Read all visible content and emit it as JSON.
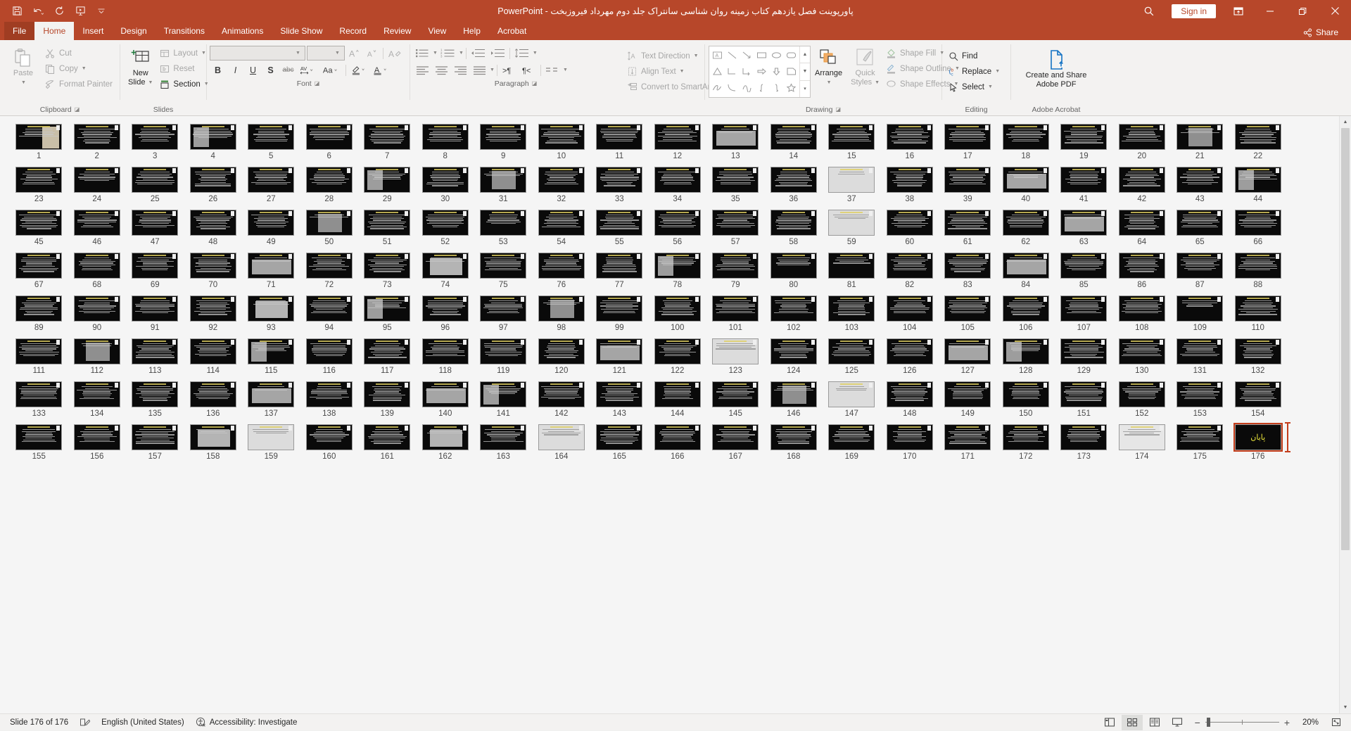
{
  "window": {
    "title": "پاورپوینت فصل یازدهم کتاب زمینه روان شناسی سانتراک جلد دوم مهرداد فیروزبخت",
    "app_suffix": "-  PowerPoint",
    "signin_label": "Sign in",
    "search_icon": "search-icon",
    "ribbon_display_icon": "ribbon-display-options-icon",
    "minimize_icon": "minimize-icon",
    "restore_icon": "restore-icon",
    "close_icon": "close-icon",
    "share_label": "Share"
  },
  "qat": [
    {
      "name": "save-icon",
      "label": "Save"
    },
    {
      "name": "undo-icon",
      "label": "Undo"
    },
    {
      "name": "redo-icon",
      "label": "Redo"
    },
    {
      "name": "start-from-beginning-icon",
      "label": "Start From Beginning"
    },
    {
      "name": "customize-qat-icon",
      "label": "Customize Quick Access Toolbar"
    }
  ],
  "tabs": [
    {
      "label": "File",
      "active": false,
      "file": true
    },
    {
      "label": "Home",
      "active": true,
      "file": false
    },
    {
      "label": "Insert",
      "active": false,
      "file": false
    },
    {
      "label": "Design",
      "active": false,
      "file": false
    },
    {
      "label": "Transitions",
      "active": false,
      "file": false
    },
    {
      "label": "Animations",
      "active": false,
      "file": false
    },
    {
      "label": "Slide Show",
      "active": false,
      "file": false
    },
    {
      "label": "Record",
      "active": false,
      "file": false
    },
    {
      "label": "Review",
      "active": false,
      "file": false
    },
    {
      "label": "View",
      "active": false,
      "file": false
    },
    {
      "label": "Help",
      "active": false,
      "file": false
    },
    {
      "label": "Acrobat",
      "active": false,
      "file": false
    }
  ],
  "ribbon": {
    "groups": {
      "clipboard": {
        "label": "Clipboard",
        "paste": "Paste",
        "cut": "Cut",
        "copy": "Copy",
        "format_painter": "Format Painter"
      },
      "slides": {
        "label": "Slides",
        "new_slide": "New\nSlide",
        "new_slide_line1": "New",
        "new_slide_line2": "Slide",
        "layout": "Layout",
        "reset": "Reset",
        "section": "Section"
      },
      "font": {
        "label": "Font",
        "font_name": "",
        "font_size": "",
        "increase_size": "A",
        "decrease_size": "A",
        "clear_formatting": "Clear All Formatting",
        "bold": "B",
        "italic": "I",
        "underline": "U",
        "shadow": "S",
        "strikethrough": "abc",
        "character_spacing": "AV",
        "change_case": "Aa",
        "text_highlight": "Text Highlight Color",
        "font_color": "A"
      },
      "paragraph": {
        "label": "Paragraph",
        "bullets": "Bullets",
        "numbering": "Numbering",
        "decrease_indent": "Decrease List Level",
        "increase_indent": "Increase List Level",
        "line_spacing": "Line Spacing",
        "align_left": "Align Left",
        "center": "Center",
        "align_right": "Align Right",
        "justify": "Justify",
        "ltr": "Left-to-Right Text Direction",
        "rtl": "Right-to-Left Text Direction",
        "columns": "Columns",
        "text_direction": "Text Direction",
        "align_text": "Align Text",
        "convert_smartart": "Convert to SmartArt"
      },
      "drawing": {
        "label": "Drawing",
        "arrange": "Arrange",
        "quick_styles_line1": "Quick",
        "quick_styles_line2": "Styles",
        "shape_fill": "Shape Fill",
        "shape_outline": "Shape Outline",
        "shape_effects": "Shape Effects"
      },
      "editing": {
        "label": "Editing",
        "find": "Find",
        "replace": "Replace",
        "select": "Select"
      },
      "acrobat": {
        "label": "Adobe Acrobat",
        "create_share_line1": "Create and Share",
        "create_share_line2": "Adobe PDF"
      }
    }
  },
  "status": {
    "slide_position": "Slide 176 of 176",
    "notes_icon": "notes-icon",
    "language": "English (United States)",
    "accessibility_icon": "accessibility-icon",
    "accessibility": "Accessibility: Investigate",
    "zoom_level": "20%",
    "views": [
      {
        "name": "normal-view-button",
        "label": "Normal",
        "active": false
      },
      {
        "name": "slide-sorter-view-button",
        "label": "Slide Sorter",
        "active": true
      },
      {
        "name": "reading-view-button",
        "label": "Reading View",
        "active": false
      },
      {
        "name": "slide-show-button",
        "label": "Slide Show",
        "active": false
      }
    ],
    "fit_to_window": "Fit slide to current window"
  },
  "sorter": {
    "total_slides": 176,
    "selected_slide": 176,
    "caret_after_slide": 176,
    "end_slide_text": "پایان",
    "slides": [
      {
        "n": 1,
        "type": "title-image",
        "lines": 5
      },
      {
        "n": 2,
        "type": "text",
        "lines": 9
      },
      {
        "n": 3,
        "type": "text",
        "lines": 8
      },
      {
        "n": 4,
        "type": "image-left",
        "lines": 6
      },
      {
        "n": 5,
        "type": "text",
        "lines": 8
      },
      {
        "n": 6,
        "type": "text",
        "lines": 7
      },
      {
        "n": 7,
        "type": "text",
        "lines": 9
      },
      {
        "n": 8,
        "type": "text",
        "lines": 8
      },
      {
        "n": 9,
        "type": "text",
        "lines": 8
      },
      {
        "n": 10,
        "type": "text",
        "lines": 9
      },
      {
        "n": 11,
        "type": "text",
        "lines": 8
      },
      {
        "n": 12,
        "type": "text",
        "lines": 8
      },
      {
        "n": 13,
        "type": "image-wide",
        "lines": 3
      },
      {
        "n": 14,
        "type": "text",
        "lines": 9
      },
      {
        "n": 15,
        "type": "text",
        "lines": 8
      },
      {
        "n": 16,
        "type": "text",
        "lines": 9
      },
      {
        "n": 17,
        "type": "text",
        "lines": 8
      },
      {
        "n": 18,
        "type": "text",
        "lines": 8
      },
      {
        "n": 19,
        "type": "text",
        "lines": 9
      },
      {
        "n": 20,
        "type": "text",
        "lines": 8
      },
      {
        "n": 21,
        "type": "image-center",
        "lines": 3
      },
      {
        "n": 22,
        "type": "text",
        "lines": 9
      },
      {
        "n": 23,
        "type": "text",
        "lines": 8
      },
      {
        "n": 24,
        "type": "text",
        "lines": 6
      },
      {
        "n": 25,
        "type": "text",
        "lines": 8
      },
      {
        "n": 26,
        "type": "text",
        "lines": 9
      },
      {
        "n": 27,
        "type": "text",
        "lines": 8
      },
      {
        "n": 28,
        "type": "text",
        "lines": 8
      },
      {
        "n": 29,
        "type": "image-left",
        "lines": 5
      },
      {
        "n": 30,
        "type": "text",
        "lines": 9
      },
      {
        "n": 31,
        "type": "image-center",
        "lines": 3
      },
      {
        "n": 32,
        "type": "text",
        "lines": 8
      },
      {
        "n": 33,
        "type": "text",
        "lines": 9
      },
      {
        "n": 34,
        "type": "text",
        "lines": 8
      },
      {
        "n": 35,
        "type": "text",
        "lines": 8
      },
      {
        "n": 36,
        "type": "text",
        "lines": 9
      },
      {
        "n": 37,
        "type": "image-pale",
        "lines": 2
      },
      {
        "n": 38,
        "type": "text",
        "lines": 9
      },
      {
        "n": 39,
        "type": "text",
        "lines": 8
      },
      {
        "n": 40,
        "type": "image-wide",
        "lines": 4
      },
      {
        "n": 41,
        "type": "text",
        "lines": 8
      },
      {
        "n": 42,
        "type": "text",
        "lines": 9
      },
      {
        "n": 43,
        "type": "text",
        "lines": 8
      },
      {
        "n": 44,
        "type": "image-left",
        "lines": 5
      },
      {
        "n": 45,
        "type": "text",
        "lines": 9
      },
      {
        "n": 46,
        "type": "text",
        "lines": 8
      },
      {
        "n": 47,
        "type": "text",
        "lines": 8
      },
      {
        "n": 48,
        "type": "text",
        "lines": 9
      },
      {
        "n": 49,
        "type": "text",
        "lines": 8
      },
      {
        "n": 50,
        "type": "image-center",
        "lines": 2
      },
      {
        "n": 51,
        "type": "text",
        "lines": 9
      },
      {
        "n": 52,
        "type": "text",
        "lines": 8
      },
      {
        "n": 53,
        "type": "text",
        "lines": 6
      },
      {
        "n": 54,
        "type": "text",
        "lines": 8
      },
      {
        "n": 55,
        "type": "text",
        "lines": 9
      },
      {
        "n": 56,
        "type": "text",
        "lines": 8
      },
      {
        "n": 57,
        "type": "text",
        "lines": 8
      },
      {
        "n": 58,
        "type": "text",
        "lines": 9
      },
      {
        "n": 59,
        "type": "image-pale",
        "lines": 3
      },
      {
        "n": 60,
        "type": "text",
        "lines": 8
      },
      {
        "n": 61,
        "type": "text",
        "lines": 9
      },
      {
        "n": 62,
        "type": "text",
        "lines": 8
      },
      {
        "n": 63,
        "type": "image-wide",
        "lines": 3
      },
      {
        "n": 64,
        "type": "text",
        "lines": 9
      },
      {
        "n": 65,
        "type": "text",
        "lines": 8
      },
      {
        "n": 66,
        "type": "text",
        "lines": 8
      },
      {
        "n": 67,
        "type": "text",
        "lines": 9
      },
      {
        "n": 68,
        "type": "text",
        "lines": 8
      },
      {
        "n": 69,
        "type": "text",
        "lines": 8
      },
      {
        "n": 70,
        "type": "text",
        "lines": 9
      },
      {
        "n": 71,
        "type": "image-wide",
        "lines": 3
      },
      {
        "n": 72,
        "type": "text",
        "lines": 8
      },
      {
        "n": 73,
        "type": "text",
        "lines": 9
      },
      {
        "n": 74,
        "type": "image-chart",
        "lines": 3
      },
      {
        "n": 75,
        "type": "text",
        "lines": 8
      },
      {
        "n": 76,
        "type": "text",
        "lines": 8
      },
      {
        "n": 77,
        "type": "text",
        "lines": 9
      },
      {
        "n": 78,
        "type": "image-left",
        "lines": 5
      },
      {
        "n": 79,
        "type": "text",
        "lines": 8
      },
      {
        "n": 80,
        "type": "text",
        "lines": 5
      },
      {
        "n": 81,
        "type": "text",
        "lines": 4
      },
      {
        "n": 82,
        "type": "text",
        "lines": 8
      },
      {
        "n": 83,
        "type": "text",
        "lines": 9
      },
      {
        "n": 84,
        "type": "image-wide",
        "lines": 3
      },
      {
        "n": 85,
        "type": "text",
        "lines": 8
      },
      {
        "n": 86,
        "type": "text",
        "lines": 9
      },
      {
        "n": 87,
        "type": "text",
        "lines": 8
      },
      {
        "n": 88,
        "type": "text",
        "lines": 8
      },
      {
        "n": 89,
        "type": "text",
        "lines": 9
      },
      {
        "n": 90,
        "type": "text",
        "lines": 8
      },
      {
        "n": 91,
        "type": "text",
        "lines": 8
      },
      {
        "n": 92,
        "type": "text",
        "lines": 9
      },
      {
        "n": 93,
        "type": "image-chart",
        "lines": 3
      },
      {
        "n": 94,
        "type": "text",
        "lines": 8
      },
      {
        "n": 95,
        "type": "image-left",
        "lines": 5
      },
      {
        "n": 96,
        "type": "text",
        "lines": 9
      },
      {
        "n": 97,
        "type": "text",
        "lines": 8
      },
      {
        "n": 98,
        "type": "image-center",
        "lines": 3
      },
      {
        "n": 99,
        "type": "text",
        "lines": 8
      },
      {
        "n": 100,
        "type": "text",
        "lines": 9
      },
      {
        "n": 101,
        "type": "text",
        "lines": 8
      },
      {
        "n": 102,
        "type": "text",
        "lines": 8
      },
      {
        "n": 103,
        "type": "text",
        "lines": 9
      },
      {
        "n": 104,
        "type": "text",
        "lines": 8
      },
      {
        "n": 105,
        "type": "text",
        "lines": 8
      },
      {
        "n": 106,
        "type": "text",
        "lines": 9
      },
      {
        "n": 107,
        "type": "text",
        "lines": 8
      },
      {
        "n": 108,
        "type": "text",
        "lines": 8
      },
      {
        "n": 109,
        "type": "text",
        "lines": 4
      },
      {
        "n": 110,
        "type": "text",
        "lines": 9
      },
      {
        "n": 111,
        "type": "text",
        "lines": 8
      },
      {
        "n": 112,
        "type": "image-center",
        "lines": 2
      },
      {
        "n": 113,
        "type": "text",
        "lines": 9
      },
      {
        "n": 114,
        "type": "text",
        "lines": 8
      },
      {
        "n": 115,
        "type": "image-left",
        "lines": 5
      },
      {
        "n": 116,
        "type": "text",
        "lines": 8
      },
      {
        "n": 117,
        "type": "text",
        "lines": 9
      },
      {
        "n": 118,
        "type": "text",
        "lines": 8
      },
      {
        "n": 119,
        "type": "text",
        "lines": 8
      },
      {
        "n": 120,
        "type": "text",
        "lines": 9
      },
      {
        "n": 121,
        "type": "image-wide",
        "lines": 3
      },
      {
        "n": 122,
        "type": "text",
        "lines": 8
      },
      {
        "n": 123,
        "type": "image-pale",
        "lines": 4
      },
      {
        "n": 124,
        "type": "text",
        "lines": 9
      },
      {
        "n": 125,
        "type": "text",
        "lines": 8
      },
      {
        "n": 126,
        "type": "text",
        "lines": 8
      },
      {
        "n": 127,
        "type": "image-wide",
        "lines": 3
      },
      {
        "n": 128,
        "type": "image-left",
        "lines": 5
      },
      {
        "n": 129,
        "type": "text",
        "lines": 9
      },
      {
        "n": 130,
        "type": "text",
        "lines": 8
      },
      {
        "n": 131,
        "type": "text",
        "lines": 8
      },
      {
        "n": 132,
        "type": "text",
        "lines": 9
      },
      {
        "n": 133,
        "type": "text",
        "lines": 8
      },
      {
        "n": 134,
        "type": "text",
        "lines": 8
      },
      {
        "n": 135,
        "type": "text",
        "lines": 9
      },
      {
        "n": 136,
        "type": "text",
        "lines": 8
      },
      {
        "n": 137,
        "type": "image-wide",
        "lines": 3
      },
      {
        "n": 138,
        "type": "text",
        "lines": 8
      },
      {
        "n": 139,
        "type": "text",
        "lines": 9
      },
      {
        "n": 140,
        "type": "image-wide",
        "lines": 3
      },
      {
        "n": 141,
        "type": "image-left",
        "lines": 5
      },
      {
        "n": 142,
        "type": "text",
        "lines": 8
      },
      {
        "n": 143,
        "type": "text",
        "lines": 9
      },
      {
        "n": 144,
        "type": "text",
        "lines": 8
      },
      {
        "n": 145,
        "type": "text",
        "lines": 8
      },
      {
        "n": 146,
        "type": "image-center",
        "lines": 3
      },
      {
        "n": 147,
        "type": "image-pale",
        "lines": 3
      },
      {
        "n": 148,
        "type": "text",
        "lines": 9
      },
      {
        "n": 149,
        "type": "text",
        "lines": 8
      },
      {
        "n": 150,
        "type": "text",
        "lines": 8
      },
      {
        "n": 151,
        "type": "text",
        "lines": 9
      },
      {
        "n": 152,
        "type": "text",
        "lines": 8
      },
      {
        "n": 153,
        "type": "text",
        "lines": 8
      },
      {
        "n": 154,
        "type": "text",
        "lines": 9
      },
      {
        "n": 155,
        "type": "text",
        "lines": 8
      },
      {
        "n": 156,
        "type": "text",
        "lines": 8
      },
      {
        "n": 157,
        "type": "text",
        "lines": 9
      },
      {
        "n": 158,
        "type": "image-chart",
        "lines": 3
      },
      {
        "n": 159,
        "type": "image-pale",
        "lines": 3
      },
      {
        "n": 160,
        "type": "text",
        "lines": 8
      },
      {
        "n": 161,
        "type": "text",
        "lines": 9
      },
      {
        "n": 162,
        "type": "image-chart",
        "lines": 3
      },
      {
        "n": 163,
        "type": "text",
        "lines": 8
      },
      {
        "n": 164,
        "type": "image-pale",
        "lines": 4
      },
      {
        "n": 165,
        "type": "text",
        "lines": 9
      },
      {
        "n": 166,
        "type": "text",
        "lines": 8
      },
      {
        "n": 167,
        "type": "text",
        "lines": 8
      },
      {
        "n": 168,
        "type": "text",
        "lines": 9
      },
      {
        "n": 169,
        "type": "text",
        "lines": 8
      },
      {
        "n": 170,
        "type": "text",
        "lines": 8
      },
      {
        "n": 171,
        "type": "text",
        "lines": 9
      },
      {
        "n": 172,
        "type": "text",
        "lines": 8
      },
      {
        "n": 173,
        "type": "text",
        "lines": 8
      },
      {
        "n": 174,
        "type": "image-doc",
        "lines": 4
      },
      {
        "n": 175,
        "type": "text",
        "lines": 8
      },
      {
        "n": 176,
        "type": "end",
        "lines": 0
      }
    ]
  },
  "colors": {
    "accent": "#b7472a",
    "ribbon_bg": "#f3f2f1",
    "workspace_bg": "#f5f5f5",
    "selection": "#c43e1c",
    "end_text": "#e8e33a"
  }
}
